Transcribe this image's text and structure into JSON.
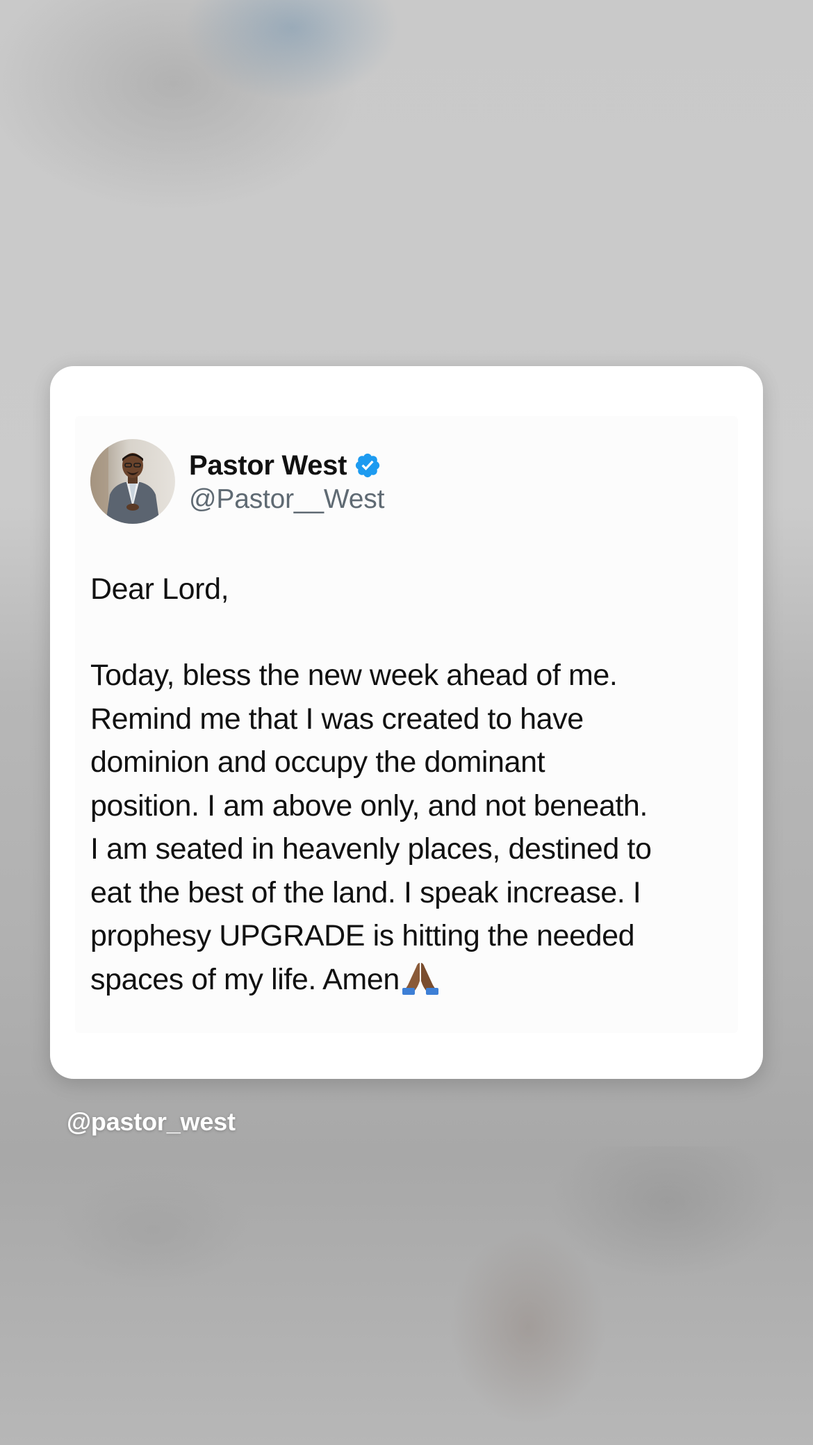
{
  "tweet": {
    "display_name": "Pastor West",
    "handle": "@Pastor__West",
    "verified": true,
    "greeting": "Dear Lord,",
    "body_lines": [
      "Today, bless the new week ahead of me.",
      "Remind me that I was created to have",
      "dominion and occupy the dominant",
      "position. I am above only, and not beneath.",
      "I am seated in heavenly places, destined to",
      "eat the best of the land. I speak increase. I",
      "prophesy UPGRADE is hitting the needed",
      "spaces of my life. Amen"
    ],
    "end_emoji": "folded-hands-icon"
  },
  "credit": {
    "username": "@pastor_west"
  },
  "colors": {
    "verified_badge": "#1d9bf0",
    "handle_text": "#5f6a73",
    "body_text": "#111111",
    "card_bg": "#ffffff"
  }
}
